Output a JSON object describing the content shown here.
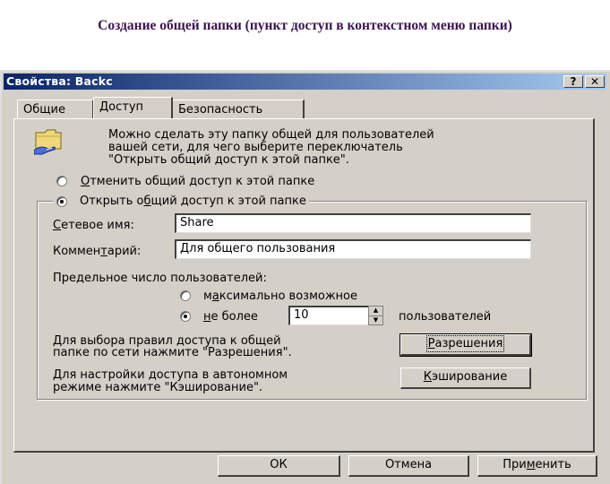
{
  "slide_title": "Создание общей папки (пункт доступ в контекстном меню папки)",
  "window": {
    "title": "Свойства: Backc",
    "help_button": "?",
    "close_button": "✕"
  },
  "tabs": [
    {
      "label": "Общие",
      "active": false
    },
    {
      "label": "Доступ",
      "active": true
    },
    {
      "label": "Безопасность",
      "active": false
    }
  ],
  "info_text": [
    "Можно сделать эту папку общей для пользователей",
    "вашей сети, для чего выберите переключатель",
    "\"Открыть общий доступ к этой папке\"."
  ],
  "radio_unshare": {
    "access_key": "О",
    "rest": "тменить общий доступ к этой папке",
    "selected": false
  },
  "radio_share": {
    "pre": "Открыть о",
    "access_key": "б",
    "rest": "щий доступ к этой папке",
    "selected": true
  },
  "share_name": {
    "access_key": "С",
    "label_rest": "етевое имя:",
    "value": "Share"
  },
  "comment": {
    "label_pre": "Коммен",
    "access_key": "т",
    "label_rest": "арий:",
    "value": "Для общего пользования"
  },
  "user_limit": {
    "label": "Предельное число пользователей:",
    "max_option": {
      "pre": "м",
      "access_key": "а",
      "rest": "ксимально возможное",
      "selected": false
    },
    "limit_option": {
      "access_key": "н",
      "rest": "е более",
      "selected": true
    },
    "value": "10",
    "suffix": "пользователей"
  },
  "permissions": {
    "text": [
      "Для выбора правил доступа к общей",
      "папке по сети нажмите \"Разрешения\"."
    ],
    "button": {
      "access_key": "Р",
      "rest": "азрешения"
    }
  },
  "caching": {
    "text": [
      "Для настройки доступа в автономном",
      "режиме нажмите \"Кэширование\"."
    ],
    "button": {
      "access_key": "К",
      "rest": "эширование"
    }
  },
  "buttons": {
    "ok": "ОК",
    "cancel": "Отмена",
    "apply": {
      "pre": "При",
      "access_key": "м",
      "rest": "енить"
    }
  }
}
